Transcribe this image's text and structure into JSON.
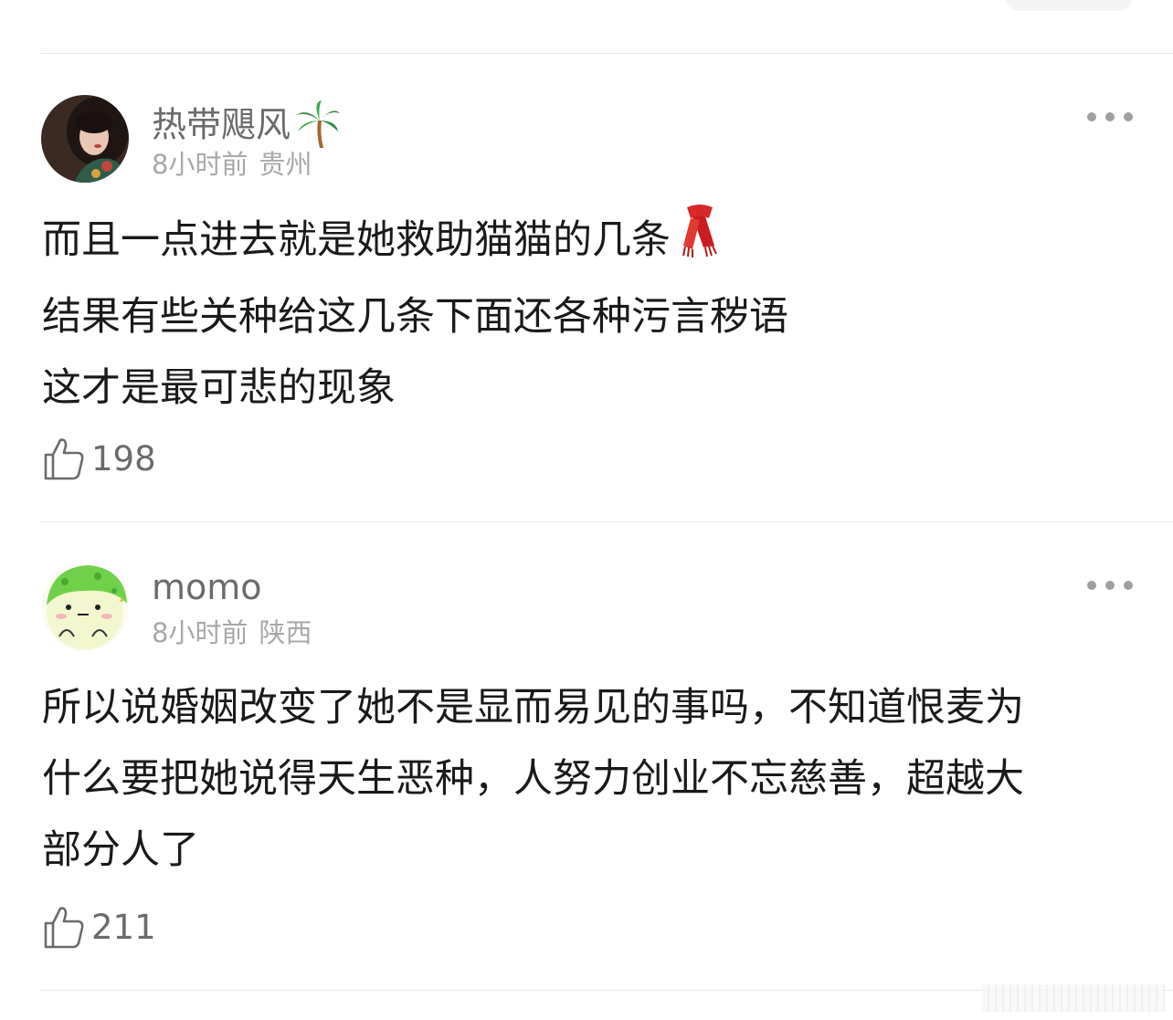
{
  "comments": [
    {
      "username": "热带飓风",
      "username_emoji": "palm-tree-icon",
      "time": "8小时前",
      "location": "贵州",
      "lines": [
        "而且一点进去就是她救助猫猫的几条",
        "结果有些关种给这几条下面还各种污言秽语",
        "这才是最可悲的现象"
      ],
      "inline_emoji": "scarf-icon",
      "likes": "198"
    },
    {
      "username": "momo",
      "time": "8小时前",
      "location": "陕西",
      "lines": [
        "所以说婚姻改变了她不是显而易见的事吗，不知道恨麦为",
        "什么要把她说得天生恶种，人努力创业不忘慈善，超越大",
        "部分人了"
      ],
      "likes": "211"
    }
  ],
  "colors": {
    "username": "#6b6b6b",
    "meta": "#a8a8a8",
    "text": "#1a1a1a",
    "divider": "#e8e8e8"
  }
}
